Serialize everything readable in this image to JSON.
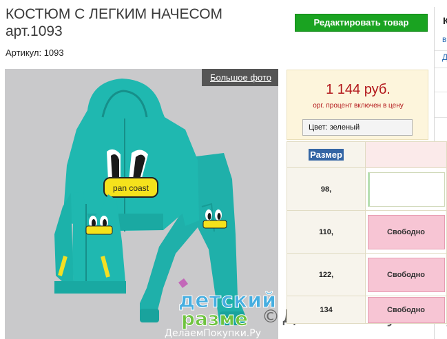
{
  "product": {
    "title_line1": "КОСТЮМ С ЛЕГКИМ НАЧЕСОМ",
    "title_line2": "арт.1093",
    "sku": "Артикул: 1093"
  },
  "toolbar": {
    "edit_label": "Редактировать товар"
  },
  "side": {
    "title": "К",
    "link1": "в",
    "link2": "Д"
  },
  "photo": {
    "big_photo_label": "Большое фото",
    "brand_text": "pan coast",
    "logo_text_line1": "детский",
    "logo_text_line2": "разме",
    "logo_subtext": "ДелаемПокупки.Ру"
  },
  "watermark": {
    "icon": "copyright-icon",
    "text": "ДелаемПокупки.Ру"
  },
  "price": {
    "amount": "1 144 руб.",
    "note": "орг. процент включен в цену",
    "color_field": "Цвет:  зеленый"
  },
  "sizes": {
    "header": "Размер",
    "rows": [
      {
        "size": "98,",
        "status": ""
      },
      {
        "size": "110,",
        "status": "Свободно"
      },
      {
        "size": "122,",
        "status": "Свободно"
      },
      {
        "size": "134",
        "status": "Свободно"
      }
    ]
  },
  "colors": {
    "accent_green": "#1aa321",
    "price_red": "#b2161a",
    "suit_teal": "#1fb8b0",
    "available_pink": "#f7c5d4"
  }
}
